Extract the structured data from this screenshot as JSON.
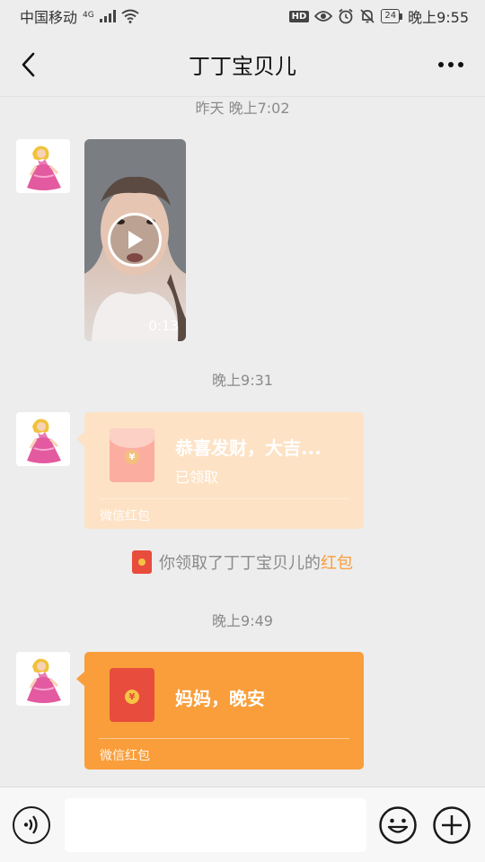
{
  "status_bar": {
    "carrier": "中国移动",
    "network": "4G",
    "hd": "HD",
    "battery": "24",
    "time": "晚上9:55"
  },
  "nav": {
    "title": "丁丁宝贝儿",
    "back_icon": "chevron-left-icon",
    "more_icon": "more-icon"
  },
  "messages": [
    {
      "type": "timestamp",
      "text": "昨天 晚上7:02"
    },
    {
      "type": "video",
      "duration": "0:13"
    },
    {
      "type": "timestamp",
      "text": "晚上9:31"
    },
    {
      "type": "red_packet",
      "title": "恭喜发财，大吉...",
      "status": "已领取",
      "footer": "微信红包",
      "opened": true
    },
    {
      "type": "notice",
      "prefix": "你领取了丁丁宝贝儿的",
      "link": "红包"
    },
    {
      "type": "timestamp",
      "text": "晚上9:49"
    },
    {
      "type": "red_packet",
      "title": "妈妈，晚安",
      "footer": "微信红包",
      "opened": false
    }
  ],
  "input_bar": {
    "voice_icon": "voice-icon",
    "emoji_icon": "emoji-icon",
    "plus_icon": "plus-icon",
    "placeholder": ""
  },
  "colors": {
    "packet_opened": "#fde2c5",
    "packet_fresh": "#f99e3b",
    "link": "#f99e3b"
  }
}
